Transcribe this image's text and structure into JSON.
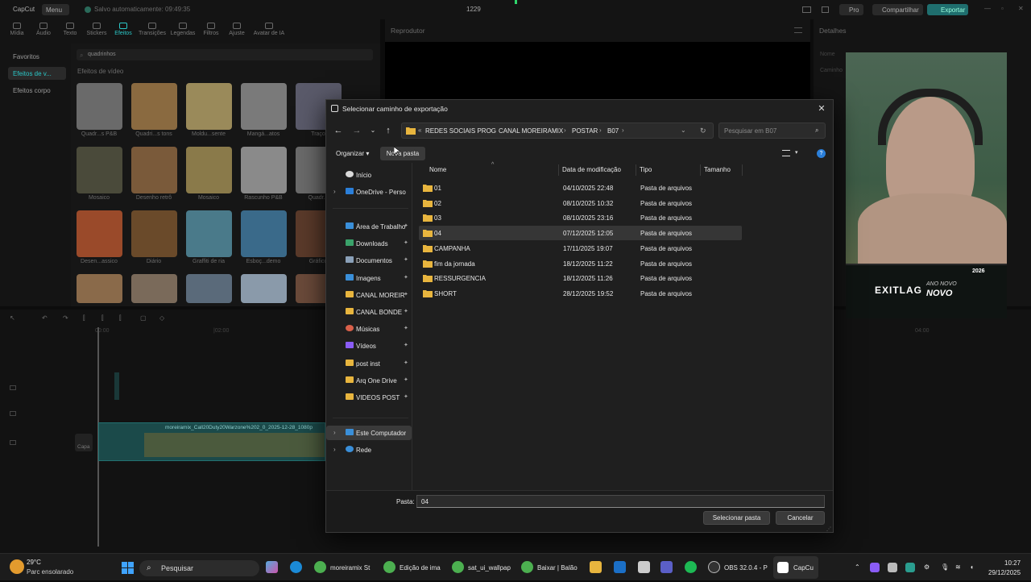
{
  "app": {
    "name": "CapCut",
    "menu_label": "Menu",
    "autosave": "Salvo automaticamente: 09:49:35",
    "project_name": "1229",
    "pro_label": "Pro",
    "share_label": "Compartilhar",
    "export_label": "Exportar"
  },
  "toolbar": {
    "items": [
      "Mídia",
      "Áudio",
      "Texto",
      "Stickers",
      "Efeitos",
      "Transições",
      "Legendas",
      "Filtros",
      "Ajuste",
      "Avatar de IA"
    ]
  },
  "left_categories": [
    "Favoritos",
    "Efeitos de v...",
    "Efeitos corpo"
  ],
  "effects": {
    "search_value": "quadrinhos",
    "section_title": "Efeitos de vídeo",
    "labels": [
      "Quadr...s P&B",
      "Quadri...s tons",
      "Moldu...sente",
      "Mangá...atos",
      "Traço",
      "Mosaico",
      "Desenho retrô",
      "Mosaico",
      "Rascunho P&B",
      "Quadr...",
      "Desen...assico",
      "Diário",
      "Graffiti de ria",
      "Esboç...demo",
      "Gráfico"
    ]
  },
  "player": {
    "title": "Reprodutor"
  },
  "details": {
    "title": "Detalhes",
    "label_name": "Nome",
    "label_path": "Caminho"
  },
  "timeline": {
    "time_start": "00:00",
    "time_mid": "|02:00",
    "time_end": "04:00",
    "clip_label": "moreiramix_Call20Duty20Warzone%202_0_2025-12-28_1080p",
    "capa_label": "Capa"
  },
  "webcam": {
    "brand": "EXITLAG",
    "promo_line1": "ANO NOVO",
    "promo_line2": "NOVO",
    "badge": "2026"
  },
  "dialog": {
    "title": "Selecionar caminho de exportação",
    "breadcrumbs": [
      "REDES SOCIAIS PROG",
      "CANAL MOREIRAMIX",
      "POSTAR",
      "B07"
    ],
    "search_placeholder": "Pesquisar em B07",
    "organize_label": "Organizar",
    "new_folder_label": "Nova pasta",
    "nav_items": [
      {
        "label": "Início",
        "icon": "home-icon"
      },
      {
        "label": "OneDrive - Persona",
        "icon": "cloud-icon"
      },
      {
        "label": "Área de Trabalho",
        "icon": "desktop-icon"
      },
      {
        "label": "Downloads",
        "icon": "download-icon"
      },
      {
        "label": "Documentos",
        "icon": "document-icon"
      },
      {
        "label": "Imagens",
        "icon": "image-icon"
      },
      {
        "label": "CANAL MOREIR",
        "icon": "folder-icon"
      },
      {
        "label": "CANAL BONDE",
        "icon": "folder-icon"
      },
      {
        "label": "Músicas",
        "icon": "music-icon"
      },
      {
        "label": "Vídeos",
        "icon": "video-icon"
      },
      {
        "label": "post inst",
        "icon": "folder-icon"
      },
      {
        "label": "Arq One Drive",
        "icon": "folder-icon"
      },
      {
        "label": "VIDEOS POST",
        "icon": "folder-icon"
      },
      {
        "label": "Este Computador",
        "icon": "computer-icon"
      },
      {
        "label": "Rede",
        "icon": "network-icon"
      }
    ],
    "columns": [
      "Nome",
      "Data de modificação",
      "Tipo",
      "Tamanho"
    ],
    "rows": [
      {
        "name": "01",
        "date": "04/10/2025 22:48",
        "type": "Pasta de arquivos"
      },
      {
        "name": "02",
        "date": "08/10/2025 10:32",
        "type": "Pasta de arquivos"
      },
      {
        "name": "03",
        "date": "08/10/2025 23:16",
        "type": "Pasta de arquivos"
      },
      {
        "name": "04",
        "date": "07/12/2025 12:05",
        "type": "Pasta de arquivos"
      },
      {
        "name": "CAMPANHA",
        "date": "17/11/2025 19:07",
        "type": "Pasta de arquivos"
      },
      {
        "name": "fim da jornada",
        "date": "18/12/2025 11:22",
        "type": "Pasta de arquivos"
      },
      {
        "name": "RESSURGENCIA",
        "date": "18/12/2025 11:26",
        "type": "Pasta de arquivos"
      },
      {
        "name": "SHORT",
        "date": "28/12/2025 19:52",
        "type": "Pasta de arquivos"
      }
    ],
    "folder_label": "Pasta:",
    "folder_value": "04",
    "select_button": "Selecionar pasta",
    "cancel_button": "Cancelar"
  },
  "taskbar": {
    "weather_temp": "29°C",
    "weather_desc": "Parc ensolarado",
    "search_label": "Pesquisar",
    "apps": [
      "moreiramix St",
      "Edição de ima",
      "sat_ui_wallpap",
      "Baixar | Balão",
      "OBS 32.0.4 - P",
      "CapCu"
    ],
    "time": "10:27",
    "date": "29/12/2025"
  },
  "colors": {
    "accent": "#2bc7c7",
    "folder": "#e8b53e",
    "dialog_bg": "#1f1f1f"
  }
}
